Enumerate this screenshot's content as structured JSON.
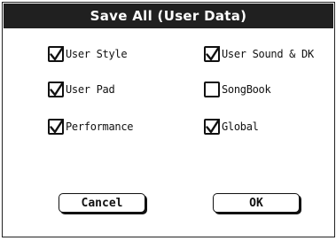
{
  "dialog": {
    "title": "Save All (User Data)"
  },
  "options": [
    {
      "label": "User Style",
      "checked": true
    },
    {
      "label": "User Sound & DK",
      "checked": true
    },
    {
      "label": "User Pad",
      "checked": true
    },
    {
      "label": "SongBook",
      "checked": false
    },
    {
      "label": "Performance",
      "checked": true
    },
    {
      "label": "Global",
      "checked": true
    }
  ],
  "buttons": {
    "cancel_label": "Cancel",
    "ok_label": "OK"
  },
  "colors": {
    "title_bg": "#202020",
    "title_fg": "#ffffff",
    "ink": "#111111",
    "background": "#ffffff"
  }
}
